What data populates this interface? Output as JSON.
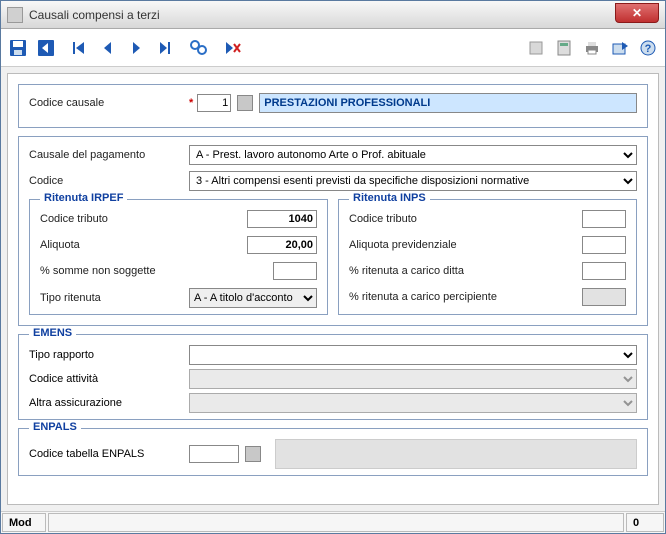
{
  "window": {
    "title": "Causali compensi a terzi"
  },
  "header": {
    "codice_causale_label": "Codice causale",
    "codice_causale_value": "1",
    "description_value": "PRESTAZIONI PROFESSIONALI"
  },
  "pagamento": {
    "causale_label": "Causale del pagamento",
    "causale_value": "A  - Prest. lavoro autonomo Arte o Prof. abituale",
    "codice_label": "Codice",
    "codice_value": "3  - Altri compensi esenti previsti da specifiche disposizioni normative"
  },
  "irpef": {
    "legend": "Ritenuta IRPEF",
    "codice_tributo_label": "Codice tributo",
    "codice_tributo_value": "1040",
    "aliquota_label": "Aliquota",
    "aliquota_value": "20,00",
    "pct_non_soggette_label": "% somme non soggette",
    "pct_non_soggette_value": "",
    "tipo_ritenuta_label": "Tipo ritenuta",
    "tipo_ritenuta_value": "A - A titolo d'acconto"
  },
  "inps": {
    "legend": "Ritenuta INPS",
    "codice_tributo_label": "Codice tributo",
    "codice_tributo_value": "",
    "aliquota_prev_label": "Aliquota previdenziale",
    "aliquota_prev_value": "",
    "pct_ditta_label": "% ritenuta a carico ditta",
    "pct_ditta_value": "",
    "pct_percipiente_label": "% ritenuta a carico percipiente",
    "pct_percipiente_value": ""
  },
  "emens": {
    "legend": "EMENS",
    "tipo_rapporto_label": "Tipo rapporto",
    "tipo_rapporto_value": "",
    "codice_attivita_label": "Codice attività",
    "codice_attivita_value": "",
    "altra_assicurazione_label": "Altra assicurazione",
    "altra_assicurazione_value": ""
  },
  "enpals": {
    "legend": "ENPALS",
    "codice_label": "Codice tabella ENPALS",
    "codice_value": ""
  },
  "status": {
    "mode": "Mod",
    "right": "0"
  }
}
